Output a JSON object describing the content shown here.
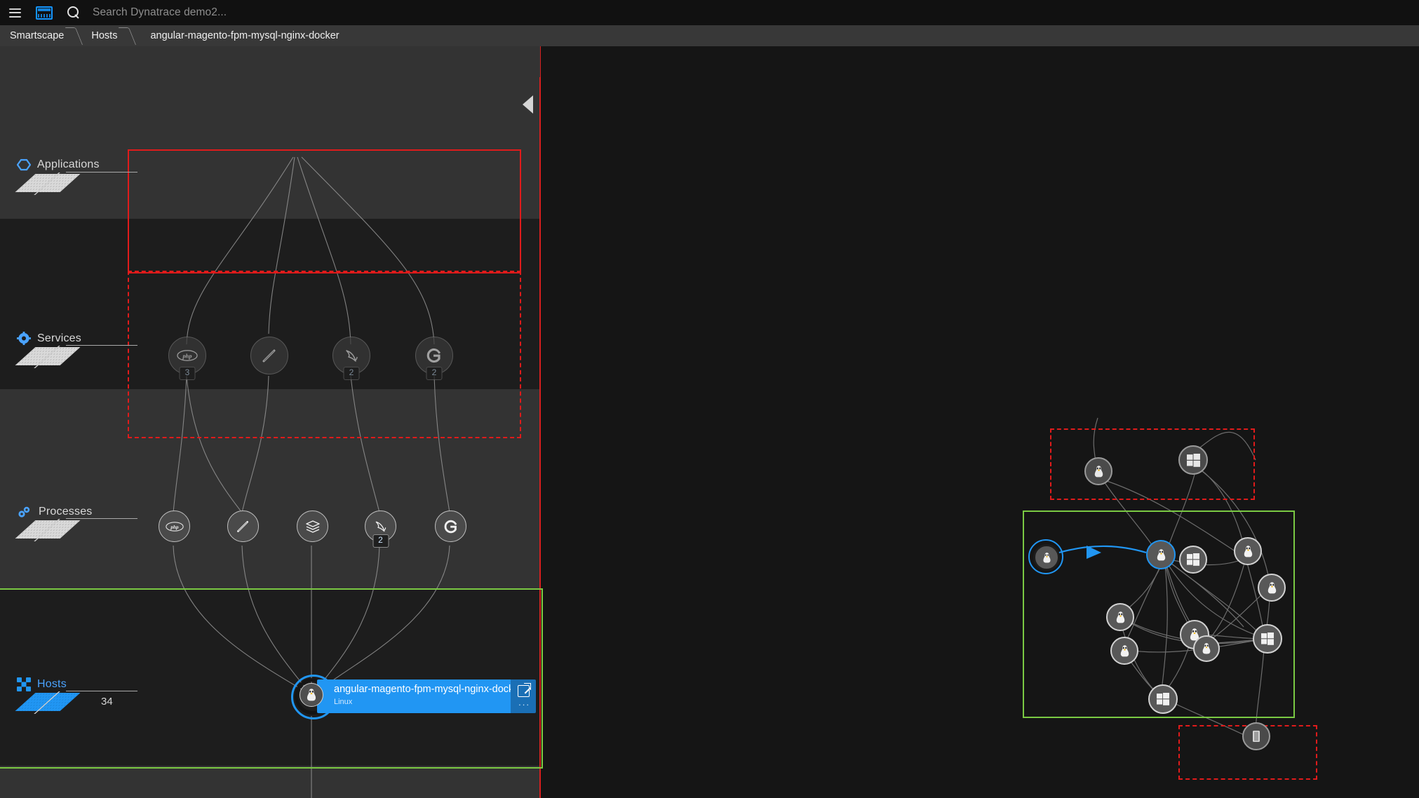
{
  "topbar": {
    "menu_icon": "hamburger-menu-icon",
    "dashboard_icon": "dashboard-monitor-icon",
    "search_icon": "search-icon",
    "search_value": "",
    "search_placeholder": "Search Dynatrace demo2..."
  },
  "breadcrumb": {
    "items": [
      {
        "label": "Smartscape"
      },
      {
        "label": "Hosts"
      },
      {
        "label": "angular-magento-fpm-mysql-nginx-docker"
      }
    ]
  },
  "lanes": [
    {
      "id": "applications",
      "label": "Applications",
      "icon": "application-hexagon-icon",
      "count": "",
      "active": false
    },
    {
      "id": "services",
      "label": "Services",
      "icon": "gear-icon",
      "count": "",
      "active": false
    },
    {
      "id": "processes",
      "label": "Processes",
      "icon": "processes-icon",
      "count": "",
      "active": false
    },
    {
      "id": "hosts",
      "label": "Hosts",
      "icon": "host-grid-icon",
      "count": "34",
      "active": true
    }
  ],
  "services_nodes": [
    {
      "icon": "php-icon",
      "badge": ""
    },
    {
      "icon": "nginx-icon",
      "badge": ""
    },
    {
      "icon": "mysql-dolphin-icon",
      "badge": "2"
    },
    {
      "icon": "go-icon",
      "badge": "2"
    }
  ],
  "services_first_badge": "3",
  "processes_nodes": [
    {
      "icon": "php-icon",
      "badge": ""
    },
    {
      "icon": "nginx-icon",
      "badge": ""
    },
    {
      "icon": "database-stack-icon",
      "badge": ""
    },
    {
      "icon": "mysql-dolphin-icon",
      "badge": "2"
    },
    {
      "icon": "go-icon",
      "badge": ""
    }
  ],
  "selected_host": {
    "name": "angular-magento-fpm-mysql-nginx-docker",
    "os": "Linux",
    "icon": "linux-tux-icon",
    "open_icon": "external-link-icon",
    "overflow": "..."
  },
  "collapse_handle": {
    "icon": "collapse-left-triangle-icon"
  },
  "minimap": {
    "regions": [
      {
        "id": "top-dashed",
        "style": "dash-red",
        "color": "#e01b1b"
      },
      {
        "id": "hosts-green",
        "style": "solid-green",
        "color": "#7ac943"
      },
      {
        "id": "bottom-dashed",
        "style": "dash-red",
        "color": "#e01b1b"
      }
    ],
    "nodes": [
      {
        "id": "m1",
        "icon": "linux-tux-icon",
        "selected": false
      },
      {
        "id": "m2",
        "icon": "windows-icon",
        "selected": false
      },
      {
        "id": "m3",
        "icon": "linux-tux-icon",
        "selected": true
      },
      {
        "id": "m4",
        "icon": "linux-tux-icon",
        "selected": false
      },
      {
        "id": "m5",
        "icon": "windows-icon",
        "selected": false
      },
      {
        "id": "m6",
        "icon": "linux-tux-icon",
        "selected": false
      },
      {
        "id": "m7",
        "icon": "linux-tux-icon",
        "selected": false
      },
      {
        "id": "m8",
        "icon": "linux-tux-icon",
        "selected": false
      },
      {
        "id": "m9",
        "icon": "linux-tux-icon",
        "selected": false
      },
      {
        "id": "m10",
        "icon": "linux-tux-icon",
        "selected": false
      },
      {
        "id": "m11",
        "icon": "linux-tux-icon",
        "selected": false
      },
      {
        "id": "m12",
        "icon": "windows-icon",
        "selected": false
      },
      {
        "id": "m13",
        "icon": "windows-icon",
        "selected": false
      },
      {
        "id": "m14",
        "icon": "server-rack-icon",
        "selected": false
      }
    ]
  },
  "colors": {
    "accent_blue": "#2196f3",
    "highlight_red": "#e01b1b",
    "highlight_green": "#7ac943",
    "topbar_bg": "#111111",
    "breadcrumb_bg": "#383838",
    "lane_light": "#333333",
    "lane_dark": "#1d1d1d",
    "canvas_bg": "#151515"
  }
}
